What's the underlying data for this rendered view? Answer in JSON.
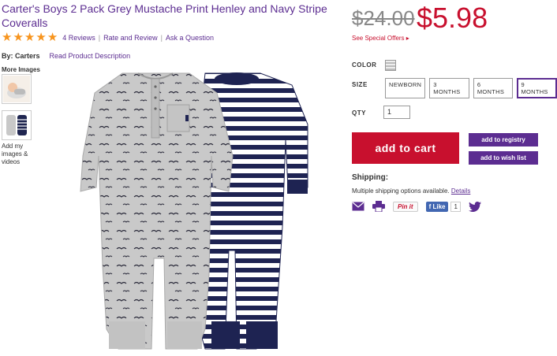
{
  "product": {
    "title": "Carter's Boys 2 Pack Grey Mustache Print Henley and Navy Stripe Coveralls",
    "reviews": "4 Reviews",
    "rate_review": "Rate and Review",
    "ask_question": "Ask a Question",
    "brand": "By: Carters",
    "read_description": "Read Product Description",
    "rating": 5
  },
  "gallery": {
    "more_images": "More Images",
    "add_images": "Add my images & videos"
  },
  "pricing": {
    "old_price": "$24.00",
    "new_price": "$5.98",
    "special_offers": "See Special Offers ▸"
  },
  "options": {
    "color_label": "COLOR",
    "size_label": "SIZE",
    "sizes": [
      "NEWBORN",
      "3 MONTHS",
      "6 MONTHS",
      "9 MONTHS"
    ],
    "selected_size": "9 MONTHS",
    "qty_label": "QTY",
    "qty_value": "1"
  },
  "actions": {
    "add_to_cart": "add to cart",
    "add_to_registry": "add to registry",
    "add_to_wishlist": "add to wish list"
  },
  "shipping": {
    "title": "Shipping:",
    "text": "Multiple shipping options available.",
    "details": "Details"
  },
  "share": {
    "pin": "Pin it",
    "like": "Like",
    "like_count": "1"
  },
  "colors": {
    "purple": "#5c2d91",
    "red": "#c8102e",
    "star": "#f7941d"
  }
}
